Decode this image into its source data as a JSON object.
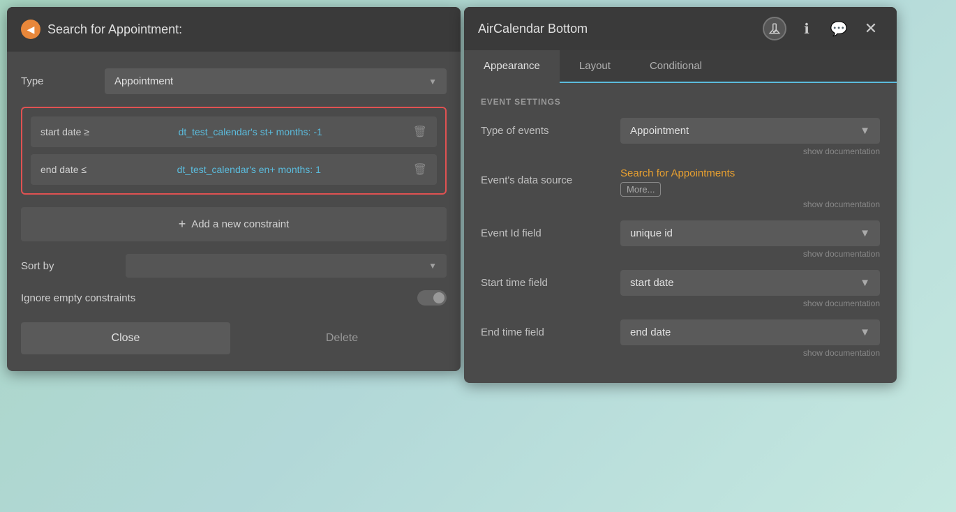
{
  "left_panel": {
    "title": "Search for Appointment:",
    "back_label": "◀",
    "type_label": "Type",
    "type_value": "Appointment",
    "constraints": [
      {
        "prefix": "start date ≥",
        "value": "dt_test_calendar's st+ months: -1"
      },
      {
        "prefix": "end date ≤",
        "value": "dt_test_calendar's en+ months: 1"
      }
    ],
    "add_constraint_label": "Add a new constraint",
    "sort_label": "Sort by",
    "sort_value": "",
    "ignore_label": "Ignore empty constraints",
    "close_label": "Close",
    "delete_label": "Delete"
  },
  "right_panel": {
    "title": "AirCalendar Bottom",
    "tabs": [
      {
        "label": "Appearance",
        "active": true
      },
      {
        "label": "Layout",
        "active": false
      },
      {
        "label": "Conditional",
        "active": false
      }
    ],
    "section_title": "EVENT SETTINGS",
    "rows": [
      {
        "label": "Type of events",
        "value": "Appointment",
        "show_doc": "show documentation"
      },
      {
        "label": "Event's data source",
        "link": "Search for Appointments",
        "more": "More...",
        "show_doc": "show documentation"
      },
      {
        "label": "Event Id field",
        "value": "unique id",
        "show_doc": "show documentation"
      },
      {
        "label": "Start time field",
        "value": "start date",
        "show_doc": "show documentation"
      },
      {
        "label": "End time field",
        "value": "end date",
        "show_doc": "show documentation"
      }
    ]
  }
}
